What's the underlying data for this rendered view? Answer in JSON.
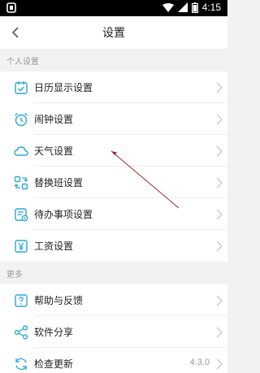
{
  "status_bar": {
    "time": "4:15"
  },
  "header": {
    "title": "设置"
  },
  "sections": {
    "personal": "个人设置",
    "more": "更多"
  },
  "rows": {
    "calendar": "日历显示设置",
    "alarm": "闹钟设置",
    "weather": "天气设置",
    "shift": "替换班设置",
    "todo": "待办事项设置",
    "salary": "工资设置",
    "help": "帮助与反馈",
    "share": "软件分享",
    "update": "检查更新"
  },
  "app_version": "4.3.0",
  "colors": {
    "accent": "#39b8e3",
    "icon": "#2aa9d8",
    "chevron": "#c8c8c8",
    "annotation": "#a02828"
  }
}
